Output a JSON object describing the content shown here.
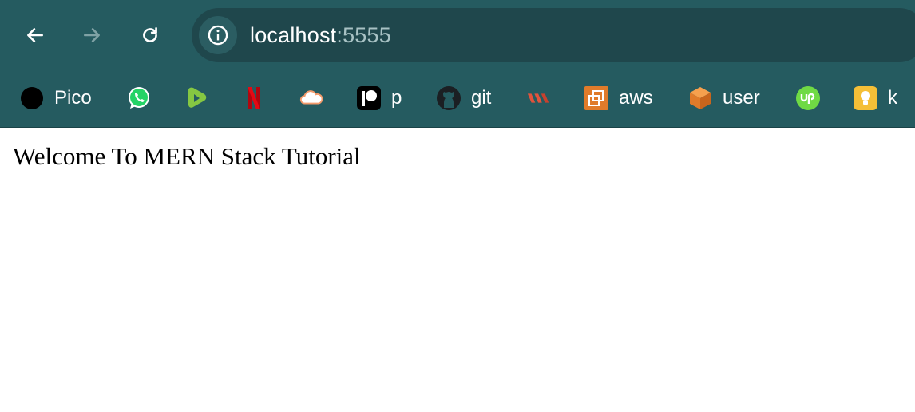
{
  "browser": {
    "url_host": "localhost",
    "url_port": ":5555",
    "icons": {
      "back": "arrow-left-icon",
      "forward": "arrow-right-icon",
      "reload": "reload-icon",
      "site_info": "info-icon"
    }
  },
  "bookmarks": [
    {
      "label": "Pico",
      "icon": "black-circle-icon"
    },
    {
      "label": "",
      "icon": "whatsapp-icon"
    },
    {
      "label": "",
      "icon": "rumble-icon"
    },
    {
      "label": "",
      "icon": "netflix-icon"
    },
    {
      "label": "",
      "icon": "cloud-icon"
    },
    {
      "label": "p",
      "icon": "patreon-icon"
    },
    {
      "label": "git",
      "icon": "github-icon"
    },
    {
      "label": "",
      "icon": "wrike-icon"
    },
    {
      "label": "aws",
      "icon": "aws-icon"
    },
    {
      "label": "user",
      "icon": "cube-icon"
    },
    {
      "label": "",
      "icon": "upwork-icon"
    },
    {
      "label": "k",
      "icon": "lightbulb-icon"
    }
  ],
  "page": {
    "heading": "Welcome To MERN Stack Tutorial"
  },
  "colors": {
    "toolbar_bg": "#255b60",
    "omnibox_bg": "#1f474c",
    "text": "#ffffff"
  }
}
